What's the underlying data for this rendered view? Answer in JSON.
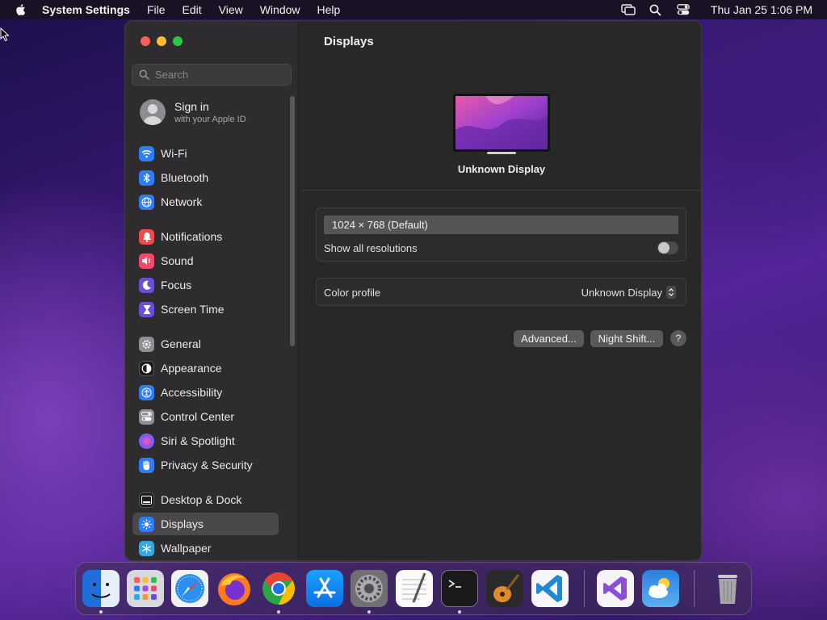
{
  "menubar": {
    "app_name": "System Settings",
    "menus": [
      "File",
      "Edit",
      "View",
      "Window",
      "Help"
    ],
    "clock": "Thu Jan 25  1:06 PM"
  },
  "sidebar": {
    "search_placeholder": "Search",
    "account": {
      "title": "Sign in",
      "subtitle": "with your Apple ID"
    },
    "items": [
      {
        "label": "Wi-Fi",
        "icon": "wifi-icon",
        "color": "#2f7df6"
      },
      {
        "label": "Bluetooth",
        "icon": "bluetooth-icon",
        "color": "#2f7df6"
      },
      {
        "label": "Network",
        "icon": "globe-icon",
        "color": "#2f7df6"
      },
      {
        "label": "Notifications",
        "icon": "bell-icon",
        "color": "#ef4b4b"
      },
      {
        "label": "Sound",
        "icon": "speaker-icon",
        "color": "#ef4b6a"
      },
      {
        "label": "Focus",
        "icon": "moon-icon",
        "color": "#6a4fd8"
      },
      {
        "label": "Screen Time",
        "icon": "hourglass-icon",
        "color": "#6a4fd8"
      },
      {
        "label": "General",
        "icon": "gear-icon",
        "color": "#8e8e93"
      },
      {
        "label": "Appearance",
        "icon": "appearance-icon",
        "color": "#1c1c1e"
      },
      {
        "label": "Accessibility",
        "icon": "accessibility-icon",
        "color": "#2f7df6"
      },
      {
        "label": "Control Center",
        "icon": "toggles-icon",
        "color": "#8e8e93"
      },
      {
        "label": "Siri & Spotlight",
        "icon": "siri-icon",
        "color": "#b44bd8"
      },
      {
        "label": "Privacy & Security",
        "icon": "hand-icon",
        "color": "#2f7df6"
      },
      {
        "label": "Desktop & Dock",
        "icon": "dock-icon",
        "color": "#1c1c1e"
      },
      {
        "label": "Displays",
        "icon": "sun-icon",
        "color": "#2f7df6"
      },
      {
        "label": "Wallpaper",
        "icon": "snowflake-icon",
        "color": "#35a8e0"
      }
    ],
    "active_item": "Displays"
  },
  "main": {
    "title": "Displays",
    "display_name": "Unknown Display",
    "resolution": "1024 × 768 (Default)",
    "show_all_label": "Show all resolutions",
    "show_all_enabled": false,
    "color_profile_label": "Color profile",
    "color_profile_value": "Unknown Display",
    "advanced_button": "Advanced...",
    "night_shift_button": "Night Shift...",
    "help_button": "?"
  },
  "dock": {
    "apps": [
      {
        "name": "Finder",
        "icon": "finder-icon",
        "running": true
      },
      {
        "name": "Launchpad",
        "icon": "launchpad-icon",
        "running": false
      },
      {
        "name": "Safari",
        "icon": "safari-icon",
        "running": false
      },
      {
        "name": "Firefox",
        "icon": "firefox-icon",
        "running": false
      },
      {
        "name": "Chrome",
        "icon": "chrome-icon",
        "running": true
      },
      {
        "name": "App Store",
        "icon": "app-store-icon",
        "running": false
      },
      {
        "name": "System Settings",
        "icon": "system-settings-icon",
        "running": true
      },
      {
        "name": "TextEdit",
        "icon": "textedit-icon",
        "running": false
      },
      {
        "name": "Terminal",
        "icon": "terminal-icon",
        "running": true
      },
      {
        "name": "GarageBand",
        "icon": "garageband-icon",
        "running": false
      },
      {
        "name": "Visual Studio Code",
        "icon": "vscode-icon",
        "running": false
      },
      {
        "name": "Visual Studio",
        "icon": "visual-studio-icon",
        "running": false
      },
      {
        "name": "Weather",
        "icon": "weather-icon",
        "running": false
      },
      {
        "name": "Trash",
        "icon": "trash-icon",
        "running": false
      }
    ]
  }
}
